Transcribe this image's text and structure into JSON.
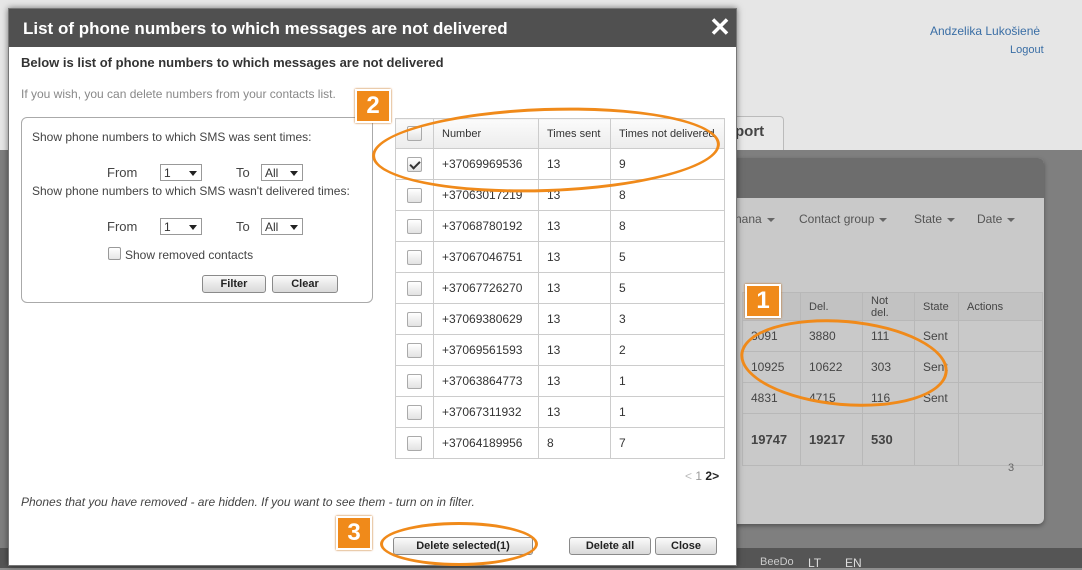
{
  "background": {
    "user_name": "Andzelika Lukošienė",
    "logout": "Logout",
    "tab_report": "port",
    "filters": [
      "nana",
      "Contact group",
      "State",
      "Date"
    ],
    "table": {
      "headers": [
        "",
        "Del.",
        "Not del.",
        "State",
        "Actions"
      ],
      "rows": [
        [
          "3091",
          "3880",
          "111",
          "Sent",
          ""
        ],
        [
          "10925",
          "10622",
          "303",
          "Sent",
          ""
        ],
        [
          "4831",
          "4715",
          "116",
          "Sent",
          ""
        ]
      ],
      "totals": [
        "19747",
        "19217",
        "530",
        "",
        ""
      ]
    },
    "pager_page": "3",
    "footer": {
      "brand": "BeeDo",
      "lang_lt": "LT",
      "lang_en": "EN"
    }
  },
  "dialog": {
    "title": "List of phone numbers to which messages are not delivered",
    "close_glyph": "✕",
    "heading": "Below is list of phone numbers to which messages are not delivered",
    "intro": "If you wish, you can delete numbers from your contacts list.",
    "filter": {
      "sent_label": "Show phone numbers to which SMS was sent times:",
      "notdel_label": "Show phone numbers to which SMS wasn't delivered times:",
      "from_label": "From",
      "to_label": "To",
      "sent_from": "1",
      "sent_to": "All",
      "notdel_from": "1",
      "notdel_to": "All",
      "show_removed_label": "Show removed contacts",
      "filter_button": "Filter",
      "clear_button": "Clear"
    },
    "table": {
      "headers": [
        "",
        "Number",
        "Times sent",
        "Times not delivered"
      ],
      "rows": [
        {
          "checked": true,
          "number": "+37069969536",
          "sent": "13",
          "not_delivered": "9"
        },
        {
          "checked": false,
          "number": "+37063017219",
          "sent": "13",
          "not_delivered": "8"
        },
        {
          "checked": false,
          "number": "+37068780192",
          "sent": "13",
          "not_delivered": "8"
        },
        {
          "checked": false,
          "number": "+37067046751",
          "sent": "13",
          "not_delivered": "5"
        },
        {
          "checked": false,
          "number": "+37067726270",
          "sent": "13",
          "not_delivered": "5"
        },
        {
          "checked": false,
          "number": "+37069380629",
          "sent": "13",
          "not_delivered": "3"
        },
        {
          "checked": false,
          "number": "+37069561593",
          "sent": "13",
          "not_delivered": "2"
        },
        {
          "checked": false,
          "number": "+37063864773",
          "sent": "13",
          "not_delivered": "1"
        },
        {
          "checked": false,
          "number": "+37067311932",
          "sent": "13",
          "not_delivered": "1"
        },
        {
          "checked": false,
          "number": "+37064189956",
          "sent": "8",
          "not_delivered": "7"
        }
      ]
    },
    "pager": {
      "prev": "<",
      "page1": "1",
      "page2": "2",
      "next": ">"
    },
    "note": "Phones that you have removed - are hidden. If you want to see them - turn on in filter.",
    "buttons": {
      "delete_selected": "Delete selected(1)",
      "delete_all": "Delete all",
      "close": "Close"
    }
  },
  "annotations": [
    "1",
    "2",
    "3"
  ],
  "colors": {
    "accent": "#f08a1a",
    "title_bar": "#505050"
  }
}
